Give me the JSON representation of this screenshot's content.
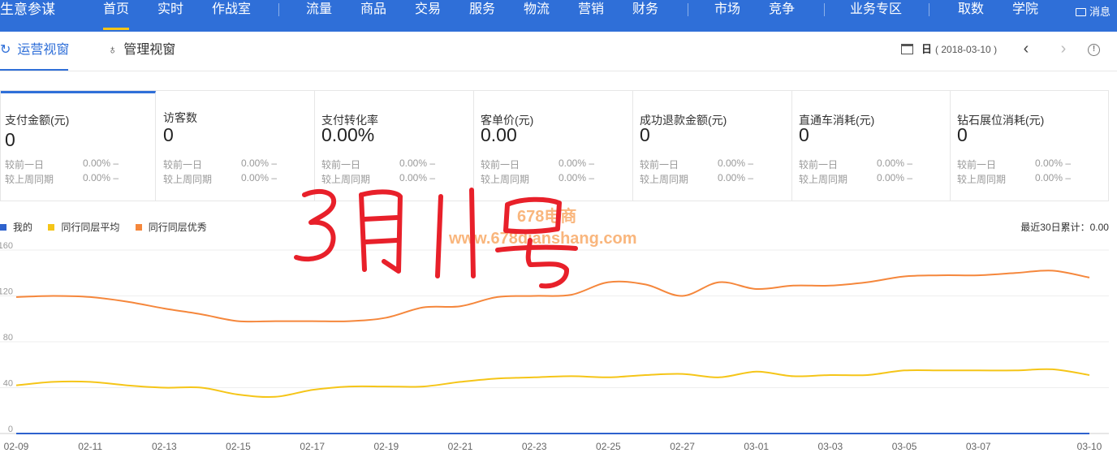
{
  "topnav": {
    "brand": "生意参谋",
    "items": [
      "首页",
      "实时",
      "作战室",
      "流量",
      "商品",
      "交易",
      "服务",
      "物流",
      "营销",
      "财务",
      "市场",
      "竞争",
      "业务专区",
      "取数",
      "学院"
    ],
    "message": "消息"
  },
  "subbar": {
    "tab_ops": "运营视窗",
    "tab_mgmt": "管理视窗",
    "date_prefix": "日",
    "date_value": "( 2018-03-10 )"
  },
  "metrics": [
    {
      "title": "支付金额(元)",
      "value": "0",
      "cmp1": "较前一日",
      "pct1": "0.00% –",
      "cmp2": "较上周同期",
      "pct2": "0.00% –"
    },
    {
      "title": "访客数",
      "value": "0",
      "cmp1": "较前一日",
      "pct1": "0.00% –",
      "cmp2": "较上周同期",
      "pct2": "0.00% –"
    },
    {
      "title": "支付转化率",
      "value": "0.00%",
      "cmp1": "较前一日",
      "pct1": "0.00% –",
      "cmp2": "较上周同期",
      "pct2": "0.00% –"
    },
    {
      "title": "客单价(元)",
      "value": "0.00",
      "cmp1": "较前一日",
      "pct1": "0.00% –",
      "cmp2": "较上周同期",
      "pct2": "0.00% –"
    },
    {
      "title": "成功退款金额(元)",
      "value": "0",
      "cmp1": "较前一日",
      "pct1": "0.00% –",
      "cmp2": "较上周同期",
      "pct2": "0.00% –"
    },
    {
      "title": "直通车消耗(元)",
      "value": "0",
      "cmp1": "较前一日",
      "pct1": "0.00% –",
      "cmp2": "较上周同期",
      "pct2": "0.00% –"
    },
    {
      "title": "钻石展位消耗(元)",
      "value": "0",
      "cmp1": "较前一日",
      "pct1": "0.00% –",
      "cmp2": "较上周同期",
      "pct2": "0.00% –"
    }
  ],
  "summary": "最近30日累计：0.00",
  "watermark": {
    "line1": "678电商",
    "line2": "www.678dianshang.com"
  },
  "annotation": "3月11号",
  "colors": {
    "nav": "#2f6fd8",
    "mine": "#2e62cd",
    "avg": "#f5c518",
    "excellent": "#f5873c"
  },
  "chart_data": {
    "type": "line",
    "title": "",
    "ylim": [
      0,
      160
    ],
    "yticks": [
      "0",
      "40",
      "80",
      "120",
      "160"
    ],
    "grid": true,
    "legend_position": "top-left",
    "x_tick_labels": [
      "02-09",
      "02-11",
      "02-13",
      "02-15",
      "02-17",
      "02-19",
      "02-21",
      "02-23",
      "02-25",
      "02-27",
      "03-01",
      "03-03",
      "03-05",
      "03-07",
      "03-10"
    ],
    "x": [
      "02-09",
      "02-10",
      "02-11",
      "02-12",
      "02-13",
      "02-14",
      "02-15",
      "02-16",
      "02-17",
      "02-18",
      "02-19",
      "02-20",
      "02-21",
      "02-22",
      "02-23",
      "02-24",
      "02-25",
      "02-26",
      "02-27",
      "02-28",
      "03-01",
      "03-02",
      "03-03",
      "03-04",
      "03-05",
      "03-06",
      "03-07",
      "03-08",
      "03-09",
      "03-10"
    ],
    "series": [
      {
        "name": "我的",
        "color": "#2e62cd",
        "values": [
          0,
          0,
          0,
          0,
          0,
          0,
          0,
          0,
          0,
          0,
          0,
          0,
          0,
          0,
          0,
          0,
          0,
          0,
          0,
          0,
          0,
          0,
          0,
          0,
          0,
          0,
          0,
          0,
          0,
          0
        ]
      },
      {
        "name": "同行同层平均",
        "color": "#f5c518",
        "values": [
          42,
          45,
          45,
          42,
          40,
          40,
          34,
          32,
          38,
          41,
          41,
          41,
          45,
          48,
          49,
          50,
          49,
          51,
          52,
          49,
          54,
          50,
          51,
          51,
          55,
          55,
          55,
          55,
          56,
          51
        ]
      },
      {
        "name": "同行同层优秀",
        "color": "#f5873c",
        "values": [
          119,
          120,
          119,
          115,
          109,
          104,
          98,
          98,
          98,
          98,
          101,
          110,
          111,
          119,
          120,
          121,
          132,
          130,
          120,
          132,
          126,
          129,
          129,
          132,
          137,
          138,
          138,
          140,
          142,
          136
        ]
      }
    ]
  }
}
